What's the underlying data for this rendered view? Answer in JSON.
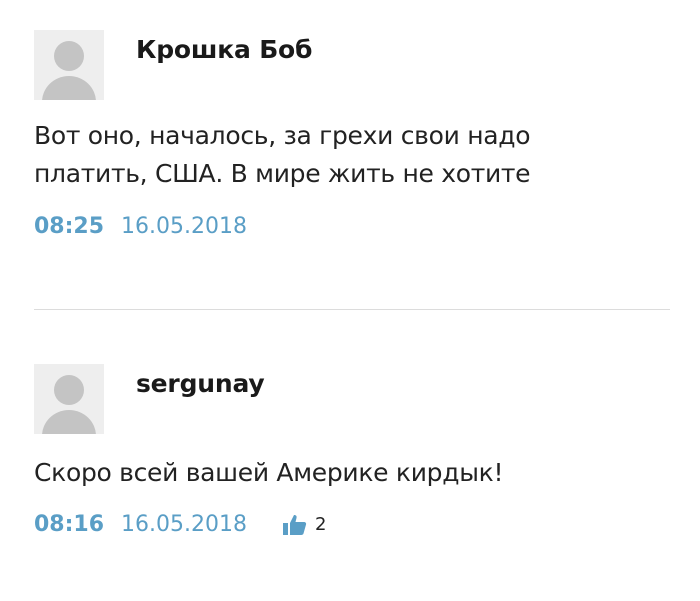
{
  "comments": [
    {
      "author": "Крошка Боб",
      "text": "Вот оно, началось, за грехи свои надо платить, США. В мире жить не хотите",
      "time": "08:25",
      "date": "16.05.2018"
    },
    {
      "author": "sergunay",
      "text": "Скоро всей вашей Америке кирдык!",
      "time": "08:16",
      "date": "16.05.2018",
      "likes": "2",
      "like_icon": "thumbs-up-icon"
    }
  ],
  "colors": {
    "meta": "#5a9ec6",
    "avatar_bg": "#eeeeee",
    "avatar_fg": "#c4c4c4"
  }
}
